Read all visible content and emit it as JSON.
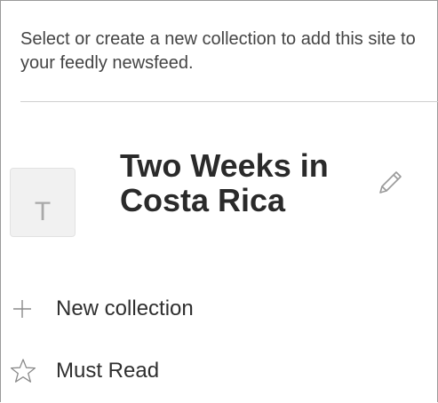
{
  "intro_text": "Select or create a new collection to add this site to your feedly newsfeed.",
  "collection": {
    "thumbnail_letter": "T",
    "title": "Two Weeks in Costa Rica",
    "edit_icon": "pencil-icon"
  },
  "actions": {
    "new_collection": {
      "icon": "plus-icon",
      "label": "New collection"
    },
    "must_read": {
      "icon": "star-outline-icon",
      "label": "Must Read"
    }
  },
  "colors": {
    "text": "#2f2f2f",
    "muted_icon": "#a9a9a9",
    "thumbnail_bg": "#f1f1f1",
    "divider": "#cfcfcf"
  }
}
